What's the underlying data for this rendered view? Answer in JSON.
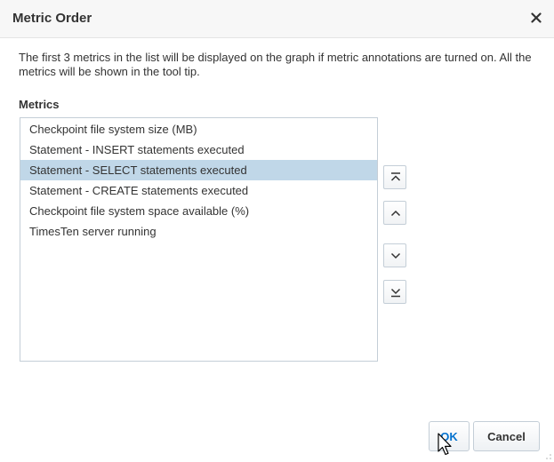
{
  "dialog": {
    "title": "Metric Order",
    "close_glyph": "✕",
    "description": "The first 3 metrics in the list will be displayed on the graph if metric annotations are turned on. All the metrics will be shown in the tool tip.",
    "metrics_label": "Metrics"
  },
  "metrics": {
    "items": [
      {
        "label": "Checkpoint file system size (MB)",
        "selected": false
      },
      {
        "label": "Statement - INSERT statements executed",
        "selected": false
      },
      {
        "label": "Statement - SELECT statements executed",
        "selected": true
      },
      {
        "label": "Statement - CREATE statements executed",
        "selected": false
      },
      {
        "label": "Checkpoint file system space available (%)",
        "selected": false
      },
      {
        "label": "TimesTen server running",
        "selected": false
      }
    ],
    "selected_color": "#c0d7e8"
  },
  "reorder_buttons": [
    {
      "name": "move-to-top-button",
      "icon": "move-top-icon"
    },
    {
      "name": "move-up-button",
      "icon": "chevron-up-icon"
    },
    {
      "name": "move-down-button",
      "icon": "chevron-down-icon"
    },
    {
      "name": "move-to-bottom-button",
      "icon": "move-bottom-icon"
    }
  ],
  "footer": {
    "ok_label": "OK",
    "cancel_label": "Cancel"
  },
  "colors": {
    "accent": "#0572ce",
    "titlebar_bg": "#f7f7f7",
    "border": "#c4ced7"
  }
}
